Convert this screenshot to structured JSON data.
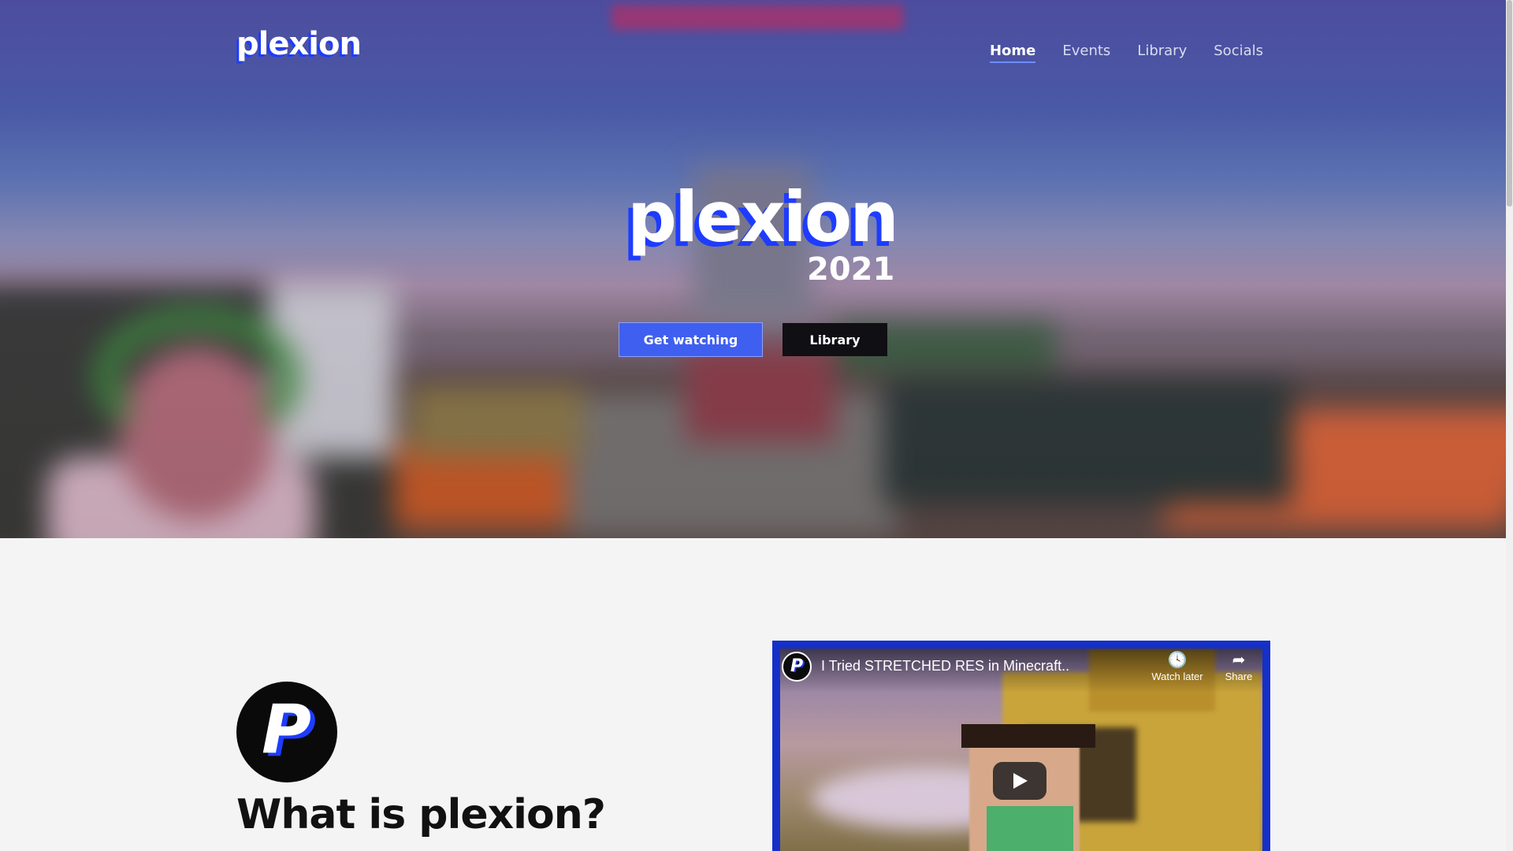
{
  "site": {
    "logo_text": "plexion"
  },
  "nav": {
    "items": [
      {
        "label": "Home",
        "active": true
      },
      {
        "label": "Events",
        "active": false
      },
      {
        "label": "Library",
        "active": false
      },
      {
        "label": "Socials",
        "active": false
      }
    ]
  },
  "hero": {
    "title": "plexion",
    "year": "2021",
    "primary_button": "Get watching",
    "secondary_button": "Library"
  },
  "about": {
    "logo_glyph": "P",
    "heading": "What is plexion?"
  },
  "video": {
    "channel_glyph": "P",
    "title": "I Tried STRETCHED RES in Minecraft..",
    "watch_later_label": "Watch later",
    "share_label": "Share",
    "icons": {
      "watch_later": "clock-icon",
      "share": "share-arrow-icon",
      "play": "play-icon"
    }
  },
  "colors": {
    "accent_blue": "#1e3cff",
    "primary_button": "#3f5ff0",
    "dark_button": "#0f0f14"
  }
}
